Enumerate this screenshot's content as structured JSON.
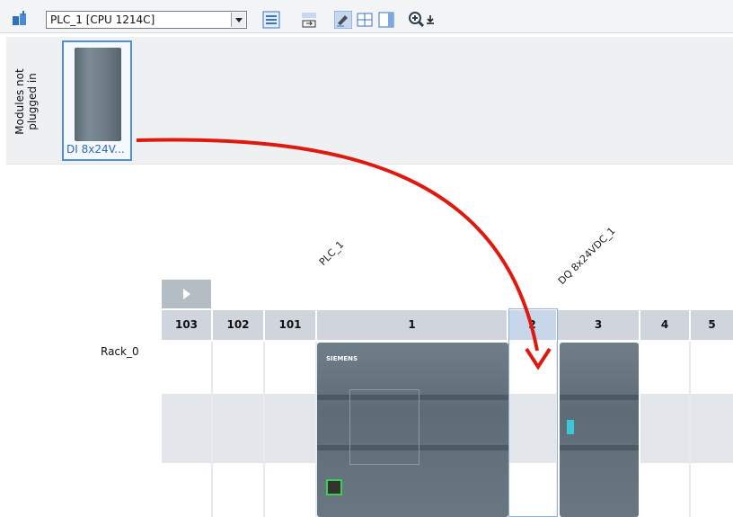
{
  "toolbar": {
    "device_select_value": "PLC_1 [CPU 1214C]"
  },
  "unplugged": {
    "title_line1": "Modules not",
    "title_line2": "plugged in",
    "module_label": "DI 8x24V..."
  },
  "rack": {
    "name": "Rack_0",
    "device_labels": [
      "PLC_1",
      "DQ 8x24VDC_1"
    ],
    "slots": [
      "103",
      "102",
      "101",
      "1",
      "2",
      "3",
      "4",
      "5"
    ]
  },
  "colors": {
    "arrow": "#e0190f",
    "selection": "#4d8fd8",
    "header": "#d0d5dd"
  }
}
